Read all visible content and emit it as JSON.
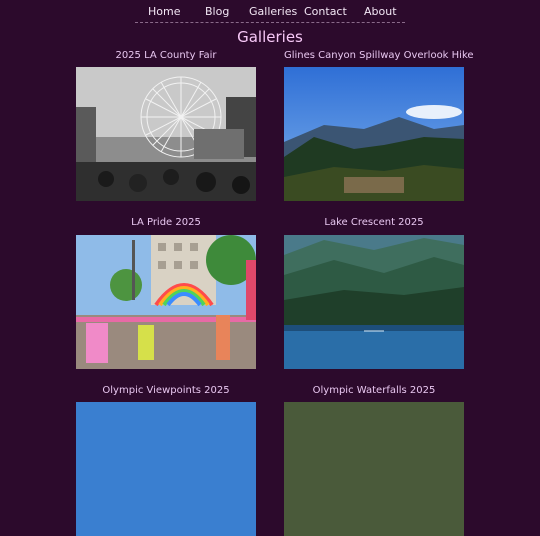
{
  "nav": {
    "items": [
      {
        "label": "Home"
      },
      {
        "label": "Blog"
      },
      {
        "label": "Galleries"
      },
      {
        "label": "Contact"
      },
      {
        "label": "About"
      }
    ]
  },
  "page": {
    "title": "Galleries"
  },
  "galleries": [
    {
      "title": "2025 LA County Fair"
    },
    {
      "title": "Glines Canyon Spillway Overlook Hike"
    },
    {
      "title": "LA Pride 2025"
    },
    {
      "title": "Lake Crescent 2025"
    },
    {
      "title": "Olympic Viewpoints 2025"
    },
    {
      "title": "Olympic Waterfalls 2025"
    }
  ]
}
